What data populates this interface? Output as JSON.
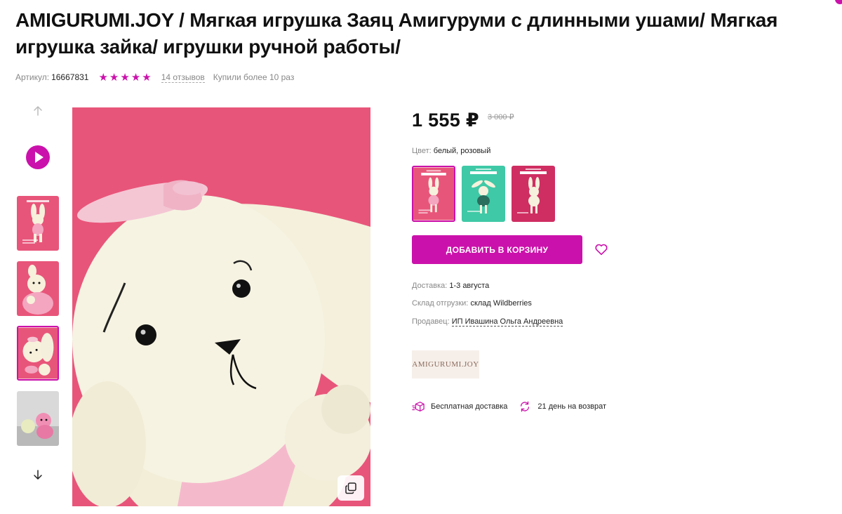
{
  "product": {
    "title": "AMIGURUMI.JOY / Мягкая игрушка Заяц Амигуруми с длинными ушами/ Мягкая игрушка зайка/ игрушки ручной работы/",
    "article_label": "Артикул:",
    "article_value": "16667831",
    "rating_stars": 5,
    "reviews_text": "14 отзывов",
    "bought_text": "Купили более 10 раз"
  },
  "gallery": {
    "thumbnail_count": 4,
    "active_thumbnail": 3
  },
  "price": {
    "current": "1 555 ₽",
    "old": "3 000 ₽"
  },
  "color": {
    "label": "Цвет:",
    "value": "белый, розовый",
    "variants": [
      {
        "bg": "#e8557a",
        "active": true
      },
      {
        "bg": "#3fc9a6",
        "active": false
      },
      {
        "bg": "#cf2e62",
        "active": false
      }
    ]
  },
  "actions": {
    "add_to_cart": "ДОБАВИТЬ В КОРЗИНУ"
  },
  "delivery": {
    "date_label": "Доставка:",
    "date_value": "1-3 августа",
    "warehouse_label": "Склад отгрузки:",
    "warehouse_value": "склад Wildberries",
    "seller_label": "Продавец:",
    "seller_value": "ИП Ивашина Ольга Андреевна"
  },
  "brand": {
    "logo_text": "AMIGURUMI.JOY"
  },
  "perks": {
    "free_delivery": "Бесплатная доставка",
    "return": "21 день на возврат"
  },
  "colors": {
    "accent": "#cb11ab",
    "photo_bg": "#e8557a"
  }
}
